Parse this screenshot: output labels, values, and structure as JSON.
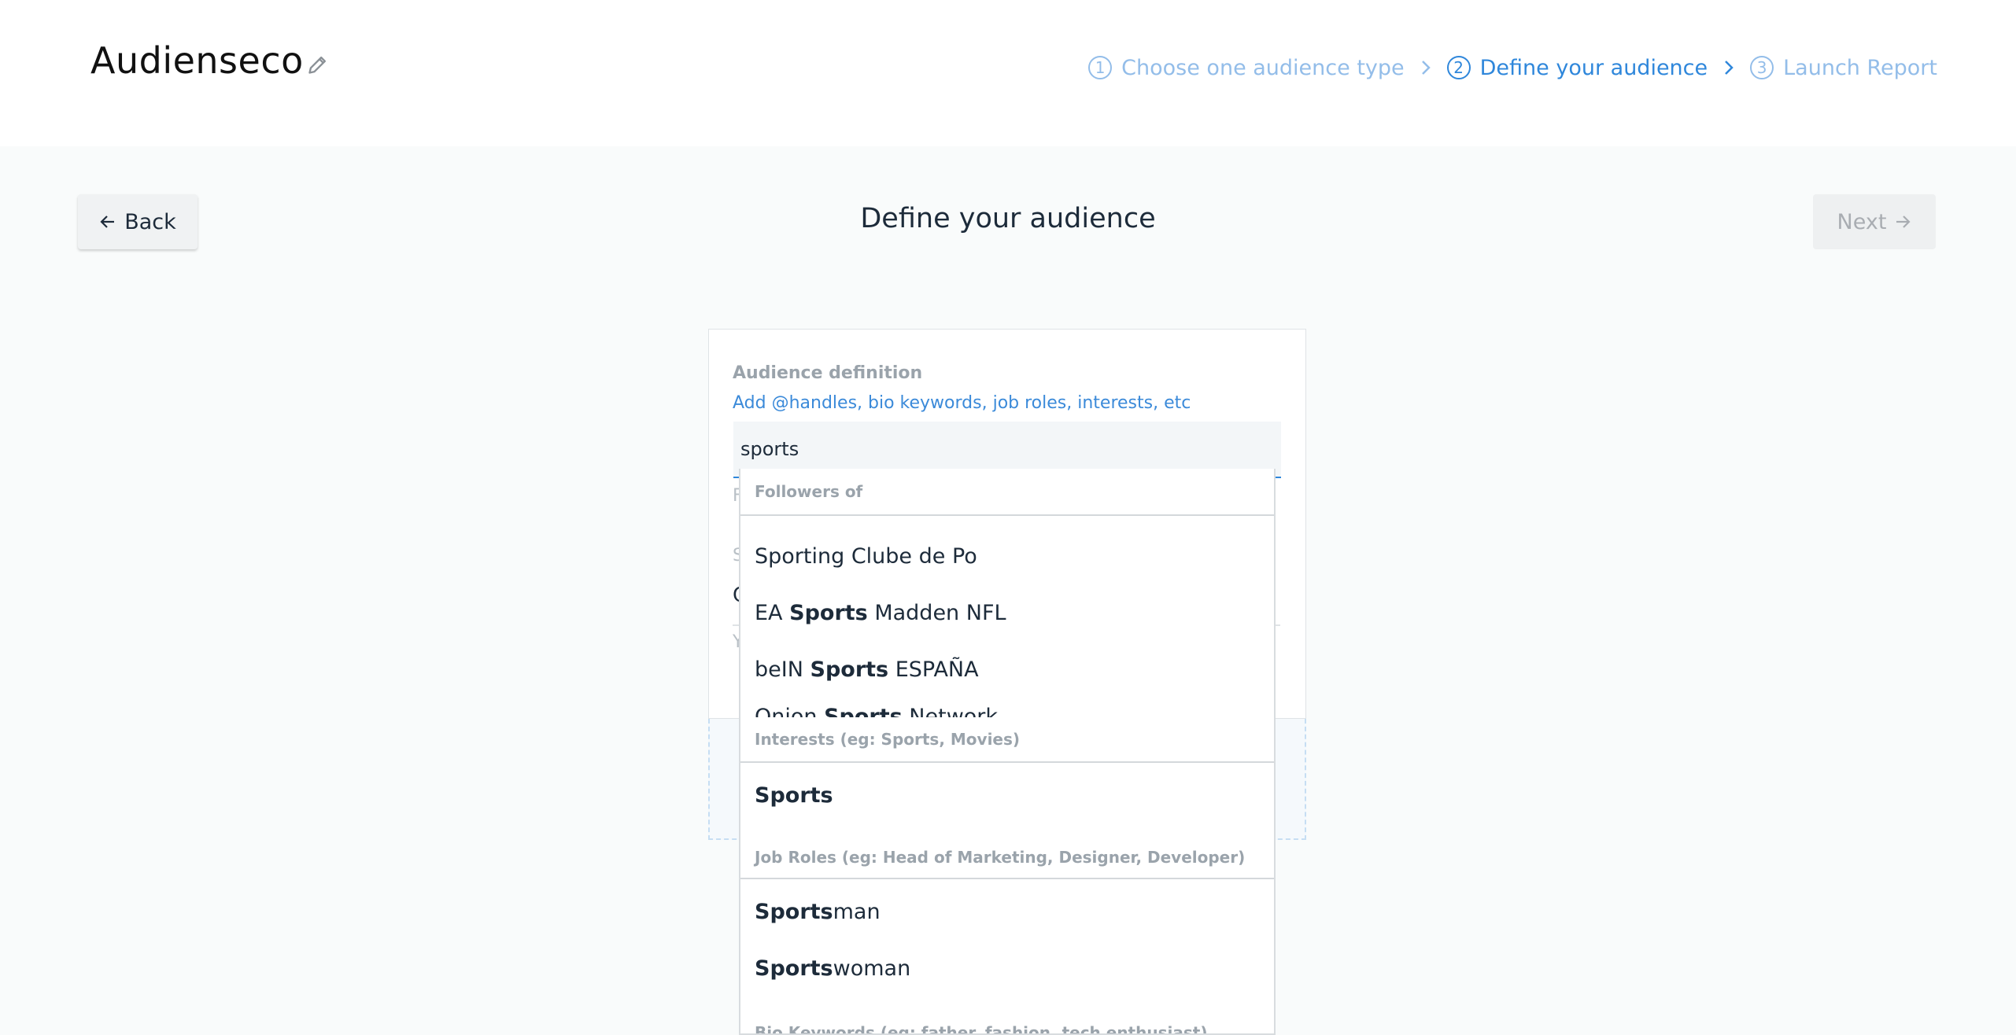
{
  "header": {
    "app_title": "Audienseco",
    "edit_icon": "pencil-icon",
    "steps": [
      {
        "number": "1",
        "label": "Choose one audience type",
        "state": "inactive"
      },
      {
        "number": "2",
        "label": "Define your audience",
        "state": "active"
      },
      {
        "number": "3",
        "label": "Launch Report",
        "state": "inactive"
      }
    ]
  },
  "toolbar": {
    "back_label": "Back",
    "next_label": "Next",
    "page_title": "Define your audience"
  },
  "form": {
    "label": "Audience definition",
    "hint": "Add @handles, bio keywords, job roles, interests, etc",
    "search_value": "sports",
    "partially_hidden": [
      "F",
      "S",
      "C",
      "Y"
    ]
  },
  "dropdown": {
    "sections": [
      {
        "title": "Followers of",
        "items": [
          {
            "pre": "Sporting Clube de Po",
            "bold": "",
            "post": ""
          },
          {
            "pre": "EA ",
            "bold": "Sports",
            "post": " Madden NFL"
          },
          {
            "pre": "beIN ",
            "bold": "Sports",
            "post": " ESPAÑA"
          },
          {
            "pre": "Onion ",
            "bold": "Sports",
            "post": " Network"
          }
        ]
      },
      {
        "title": "Interests (eg: Sports, Movies)",
        "items": [
          {
            "pre": "",
            "bold": "Sports",
            "post": ""
          }
        ]
      },
      {
        "title": "Job Roles (eg: Head of Marketing, Designer, Developer)",
        "items": [
          {
            "pre": "",
            "bold": "Sports",
            "post": "man"
          },
          {
            "pre": "",
            "bold": "Sports",
            "post": "woman"
          }
        ]
      },
      {
        "title": "Bio Keywords (eg: father, fashion, tech enthusiast)",
        "items": []
      }
    ]
  },
  "colors": {
    "accent": "#2f87db",
    "accent_light": "#93bde9",
    "background": "#f9fbfb",
    "muted_text": "#9aa3ab"
  }
}
